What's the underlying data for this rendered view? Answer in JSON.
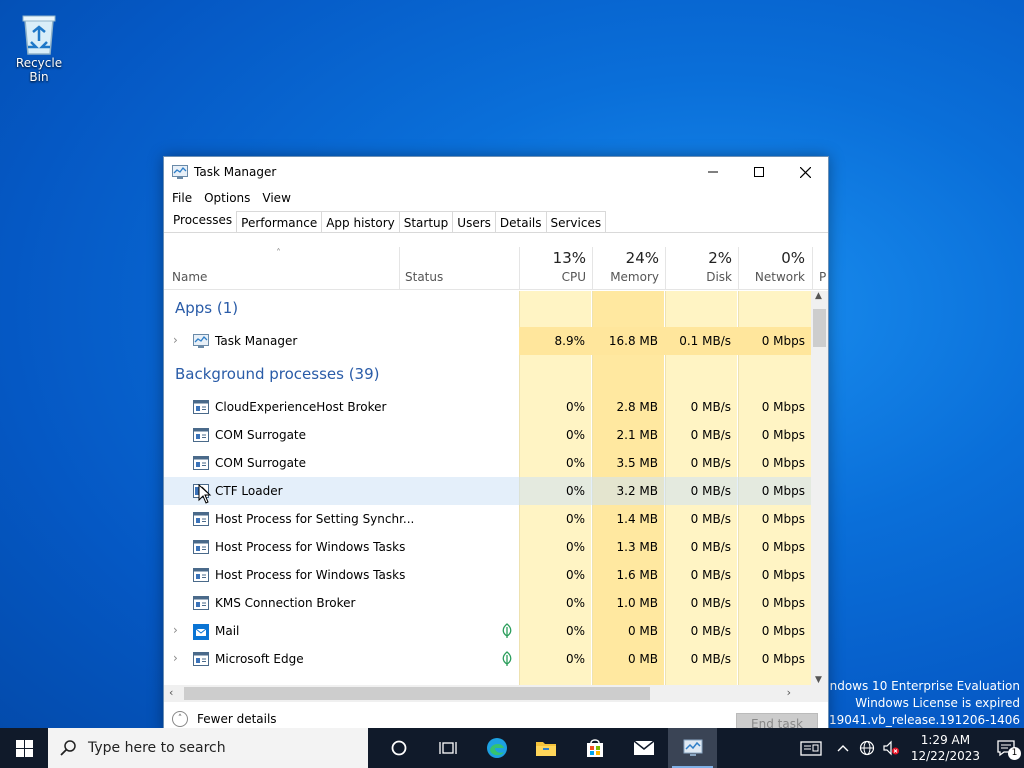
{
  "desktop": {
    "recycle_bin_label": "Recycle Bin",
    "watermark": {
      "line1": "Windows 10 Enterprise Evaluation",
      "line2": "Windows License is expired",
      "line3": "Build 19041.vb_release.191206-1406"
    }
  },
  "window": {
    "title": "Task Manager",
    "menu": [
      "File",
      "Options",
      "View"
    ],
    "tabs": [
      "Processes",
      "Performance",
      "App history",
      "Startup",
      "Users",
      "Details",
      "Services"
    ],
    "active_tab": "Processes",
    "columns": {
      "name": "Name",
      "status": "Status",
      "cpu": {
        "pct": "13%",
        "label": "CPU"
      },
      "memory": {
        "pct": "24%",
        "label": "Memory"
      },
      "disk": {
        "pct": "2%",
        "label": "Disk"
      },
      "network": {
        "pct": "0%",
        "label": "Network"
      },
      "power_partial": "P"
    },
    "groups": {
      "apps": "Apps (1)",
      "background": "Background processes (39)"
    },
    "apps": [
      {
        "name": "Task Manager",
        "cpu": "8.9%",
        "memory": "16.8 MB",
        "disk": "0.1 MB/s",
        "network": "0 Mbps",
        "expandable": true,
        "icon": "task-manager-icon"
      }
    ],
    "background": [
      {
        "name": "CloudExperienceHost Broker",
        "cpu": "0%",
        "memory": "2.8 MB",
        "disk": "0 MB/s",
        "network": "0 Mbps",
        "icon": "service-window-icon"
      },
      {
        "name": "COM Surrogate",
        "cpu": "0%",
        "memory": "2.1 MB",
        "disk": "0 MB/s",
        "network": "0 Mbps",
        "icon": "service-window-icon"
      },
      {
        "name": "COM Surrogate",
        "cpu": "0%",
        "memory": "3.5 MB",
        "disk": "0 MB/s",
        "network": "0 Mbps",
        "icon": "service-window-icon"
      },
      {
        "name": "CTF Loader",
        "cpu": "0%",
        "memory": "3.2 MB",
        "disk": "0 MB/s",
        "network": "0 Mbps",
        "icon": "ctf-loader-icon",
        "hover": true
      },
      {
        "name": "Host Process for Setting Synchr...",
        "cpu": "0%",
        "memory": "1.4 MB",
        "disk": "0 MB/s",
        "network": "0 Mbps",
        "icon": "service-window-icon"
      },
      {
        "name": "Host Process for Windows Tasks",
        "cpu": "0%",
        "memory": "1.3 MB",
        "disk": "0 MB/s",
        "network": "0 Mbps",
        "icon": "service-window-icon"
      },
      {
        "name": "Host Process for Windows Tasks",
        "cpu": "0%",
        "memory": "1.6 MB",
        "disk": "0 MB/s",
        "network": "0 Mbps",
        "icon": "service-window-icon"
      },
      {
        "name": "KMS Connection Broker",
        "cpu": "0%",
        "memory": "1.0 MB",
        "disk": "0 MB/s",
        "network": "0 Mbps",
        "icon": "service-window-icon"
      },
      {
        "name": "Mail",
        "cpu": "0%",
        "memory": "0 MB",
        "disk": "0 MB/s",
        "network": "0 Mbps",
        "icon": "mail-app-icon",
        "expandable": true,
        "suspended": true
      },
      {
        "name": "Microsoft Edge",
        "cpu": "0%",
        "memory": "0 MB",
        "disk": "0 MB/s",
        "network": "0 Mbps",
        "icon": "service-window-icon",
        "expandable": true,
        "suspended": true
      }
    ],
    "fewer_details": "Fewer details",
    "end_task": "End task"
  },
  "taskbar": {
    "search_placeholder": "Type here to search",
    "pinned": [
      "cortana-icon",
      "task-view-icon",
      "edge-icon",
      "file-explorer-icon",
      "store-icon",
      "mail-icon",
      "task-manager-icon"
    ],
    "clock_time": "1:29 AM",
    "clock_date": "12/22/2023",
    "notification_count": "1"
  },
  "colors": {
    "accent": "#0078d7",
    "group_heading": "#2a5ca8",
    "heat_light": "#fff4c4",
    "heat_medium": "#ffe8a0",
    "heat_strong": "#ffd97a"
  }
}
